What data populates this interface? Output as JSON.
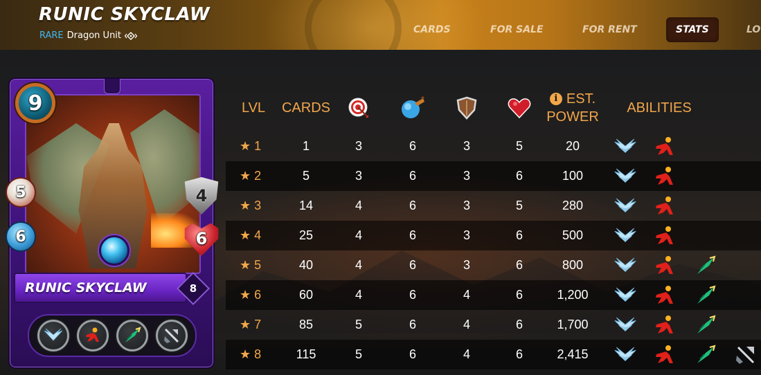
{
  "header": {
    "title": "RUNIC SKYCLAW",
    "rarity": "RARE",
    "unit_type": "Dragon Unit",
    "nav": [
      "CARDS",
      "FOR SALE",
      "FOR RENT",
      "STATS",
      "LO"
    ],
    "active_tab": "STATS"
  },
  "card": {
    "name": "RUNIC SKYCLAW",
    "level": "8",
    "mana": "9",
    "ranged": "5",
    "magic": "6",
    "armor": "4",
    "health": "6",
    "abilities": [
      "flying-icon",
      "dodge-icon",
      "sneak-icon",
      "piercing-icon"
    ]
  },
  "table": {
    "headers": {
      "lvl": "LVL",
      "cards": "CARDS",
      "ranged_icon": "ranged-target-icon",
      "magic_icon": "magic-orb-icon",
      "armor_icon": "shield-icon",
      "health_icon": "heart-icon",
      "power_line1": "EST.",
      "power_line2": "POWER",
      "abilities": "ABILITIES"
    },
    "rows": [
      {
        "lvl": "1",
        "cards": "1",
        "ranged": "3",
        "magic": "6",
        "armor": "3",
        "health": "5",
        "power": "20",
        "abilities": [
          "flying-icon",
          "dodge-icon"
        ]
      },
      {
        "lvl": "2",
        "cards": "5",
        "ranged": "3",
        "magic": "6",
        "armor": "3",
        "health": "6",
        "power": "100",
        "abilities": [
          "flying-icon",
          "dodge-icon"
        ]
      },
      {
        "lvl": "3",
        "cards": "14",
        "ranged": "4",
        "magic": "6",
        "armor": "3",
        "health": "5",
        "power": "280",
        "abilities": [
          "flying-icon",
          "dodge-icon"
        ]
      },
      {
        "lvl": "4",
        "cards": "25",
        "ranged": "4",
        "magic": "6",
        "armor": "3",
        "health": "6",
        "power": "500",
        "abilities": [
          "flying-icon",
          "dodge-icon"
        ]
      },
      {
        "lvl": "5",
        "cards": "40",
        "ranged": "4",
        "magic": "6",
        "armor": "3",
        "health": "6",
        "power": "800",
        "abilities": [
          "flying-icon",
          "dodge-icon",
          "sneak-icon"
        ]
      },
      {
        "lvl": "6",
        "cards": "60",
        "ranged": "4",
        "magic": "6",
        "armor": "4",
        "health": "6",
        "power": "1,200",
        "abilities": [
          "flying-icon",
          "dodge-icon",
          "sneak-icon"
        ]
      },
      {
        "lvl": "7",
        "cards": "85",
        "ranged": "5",
        "magic": "6",
        "armor": "4",
        "health": "6",
        "power": "1,700",
        "abilities": [
          "flying-icon",
          "dodge-icon",
          "sneak-icon"
        ]
      },
      {
        "lvl": "8",
        "cards": "115",
        "ranged": "5",
        "magic": "6",
        "armor": "4",
        "health": "6",
        "power": "2,415",
        "abilities": [
          "flying-icon",
          "dodge-icon",
          "sneak-icon",
          "piercing-icon"
        ]
      }
    ]
  },
  "colors": {
    "accent_orange": "#f2a74a",
    "rarity_blue": "#41b6f0",
    "card_purple": "#5a1fa0"
  }
}
